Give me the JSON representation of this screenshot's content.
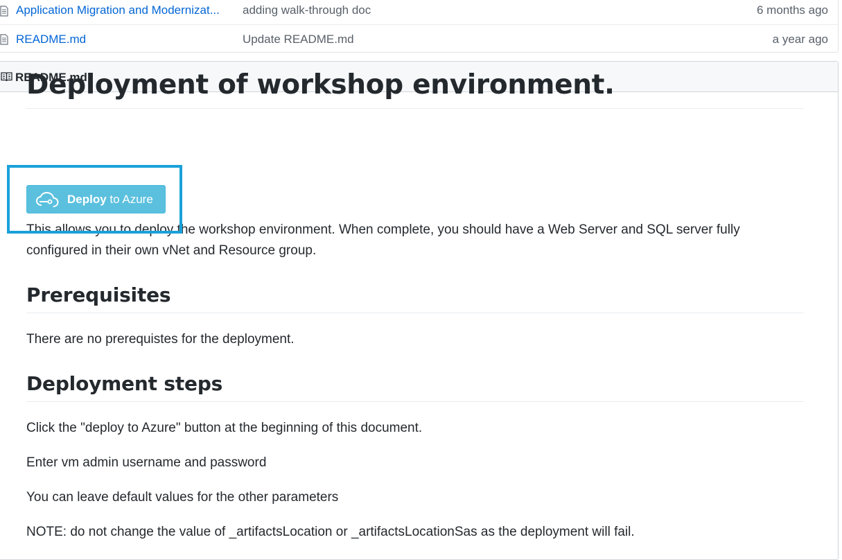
{
  "files": [
    {
      "name": "Application Migration and Modernizat...",
      "commit": "adding walk-through doc",
      "age": "6 months ago",
      "icon": "file-icon"
    },
    {
      "name": "README.md",
      "commit": "Update README.md",
      "age": "a year ago",
      "icon": "file-icon"
    }
  ],
  "readme": {
    "title": "README.md",
    "h1": "Deployment of workshop environment.",
    "deploy_button": {
      "bold": "Deploy",
      "rest": " to Azure",
      "icon": "azure-cloud-icon"
    },
    "intro": "This allows you to deploy the workshop environment. When complete, you should have a Web Server and SQL server fully configured in their own vNet and Resource group.",
    "prereq_heading": "Prerequisites",
    "prereq_text": "There are no prerequistes for the deployment.",
    "steps_heading": "Deployment steps",
    "steps": [
      "Click the \"deploy to Azure\" button at the beginning of this document.",
      "Enter vm admin username and password",
      "You can leave default values for the other parameters",
      "NOTE: do not change the value of _artifactsLocation or _artifactsLocationSas as the deployment will fail."
    ]
  },
  "colors": {
    "link": "#0366d6",
    "deploy_button": "#5bc0de",
    "highlight": "#1aa1d9"
  }
}
